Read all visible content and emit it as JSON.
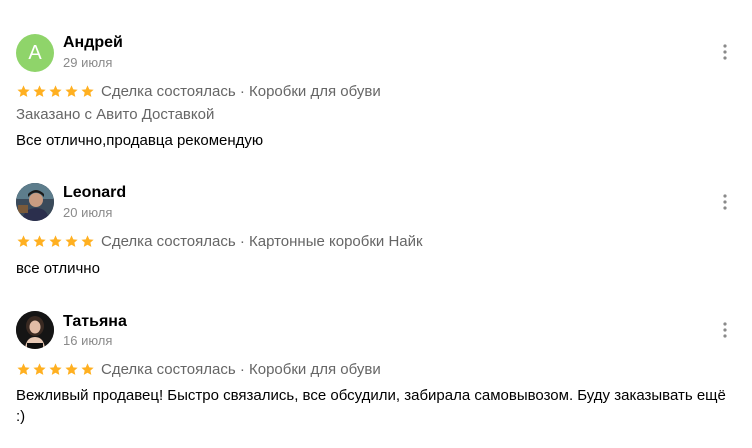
{
  "reviews": [
    {
      "author": "Андрей",
      "avatar_letter": "A",
      "date": "29 июля",
      "rating": 5,
      "meta": "Сделка состоялась · Коробки для обуви",
      "delivery": "Заказано с Авито Доставкой",
      "text": "Все отлично,продавца рекомендую"
    },
    {
      "author": "Leonard",
      "date": "20 июля",
      "rating": 5,
      "meta": "Сделка состоялась · Картонные коробки Найк",
      "text": "все отлично"
    },
    {
      "author": "Татьяна",
      "date": "16 июля",
      "rating": 5,
      "meta": "Сделка состоялась · Коробки для обуви",
      "text": "Вежливый продавец! Быстро связались, все обсудили, забирала самовывозом. Буду заказывать ещё :)"
    }
  ],
  "colors": {
    "star": "#ffb021",
    "avatar_letter_bg": "#8fd46a",
    "secondary_text": "#666666",
    "date_text": "#8a8a8a"
  },
  "icons": {
    "more": "more-vertical-icon",
    "star": "star-icon"
  }
}
